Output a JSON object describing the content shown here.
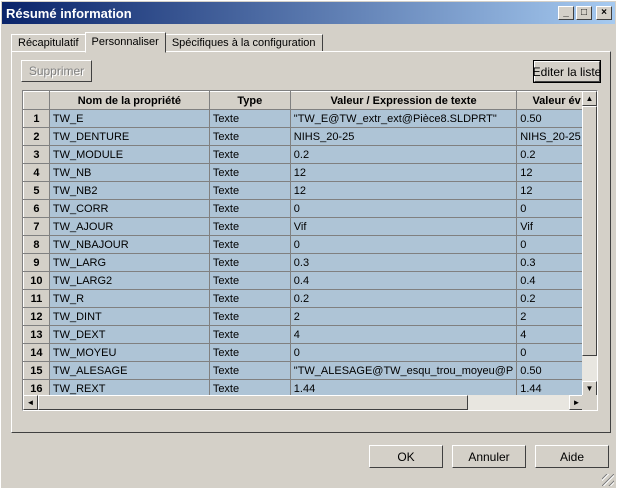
{
  "window": {
    "title": "Résumé information",
    "minimize": "_",
    "maximize": "□",
    "close": "×"
  },
  "tabs": [
    {
      "label": "Récapitulatif"
    },
    {
      "label": "Personnaliser"
    },
    {
      "label": "Spécifiques à la configuration"
    }
  ],
  "toolbar": {
    "delete_label": "Supprimer",
    "edit_list_label": "Editer la liste"
  },
  "grid": {
    "columns": [
      "Nom de la propriété",
      "Type",
      "Valeur / Expression de texte",
      "Valeur év"
    ],
    "rows": [
      {
        "num": "1",
        "name": "TW_E",
        "type": "Texte",
        "expr": "\"TW_E@TW_extr_ext@Pièce8.SLDPRT\"",
        "value": "0.50"
      },
      {
        "num": "2",
        "name": "TW_DENTURE",
        "type": "Texte",
        "expr": "NIHS_20-25",
        "value": "NIHS_20-25"
      },
      {
        "num": "3",
        "name": "TW_MODULE",
        "type": "Texte",
        "expr": "0.2",
        "value": "0.2"
      },
      {
        "num": "4",
        "name": "TW_NB",
        "type": "Texte",
        "expr": "12",
        "value": "12"
      },
      {
        "num": "5",
        "name": "TW_NB2",
        "type": "Texte",
        "expr": "12",
        "value": "12"
      },
      {
        "num": "6",
        "name": "TW_CORR",
        "type": "Texte",
        "expr": "0",
        "value": "0"
      },
      {
        "num": "7",
        "name": "TW_AJOUR",
        "type": "Texte",
        "expr": "Vif",
        "value": "Vif"
      },
      {
        "num": "8",
        "name": "TW_NBAJOUR",
        "type": "Texte",
        "expr": "0",
        "value": "0"
      },
      {
        "num": "9",
        "name": "TW_LARG",
        "type": "Texte",
        "expr": "0.3",
        "value": "0.3"
      },
      {
        "num": "10",
        "name": "TW_LARG2",
        "type": "Texte",
        "expr": "0.4",
        "value": "0.4"
      },
      {
        "num": "11",
        "name": "TW_R",
        "type": "Texte",
        "expr": "0.2",
        "value": "0.2"
      },
      {
        "num": "12",
        "name": "TW_DINT",
        "type": "Texte",
        "expr": "2",
        "value": "2"
      },
      {
        "num": "13",
        "name": "TW_DEXT",
        "type": "Texte",
        "expr": "4",
        "value": "4"
      },
      {
        "num": "14",
        "name": "TW_MOYEU",
        "type": "Texte",
        "expr": "0",
        "value": "0"
      },
      {
        "num": "15",
        "name": "TW_ALESAGE",
        "type": "Texte",
        "expr": "\"TW_ALESAGE@TW_esqu_trou_moyeu@P",
        "value": "0.50"
      },
      {
        "num": "16",
        "name": "TW_REXT",
        "type": "Texte",
        "expr": "1.44",
        "value": "1.44"
      }
    ]
  },
  "scroll": {
    "up": "▲",
    "down": "▼",
    "left": "◄",
    "right": "►"
  },
  "footer": {
    "ok_label": "OK",
    "cancel_label": "Annuler",
    "help_label": "Aide"
  }
}
